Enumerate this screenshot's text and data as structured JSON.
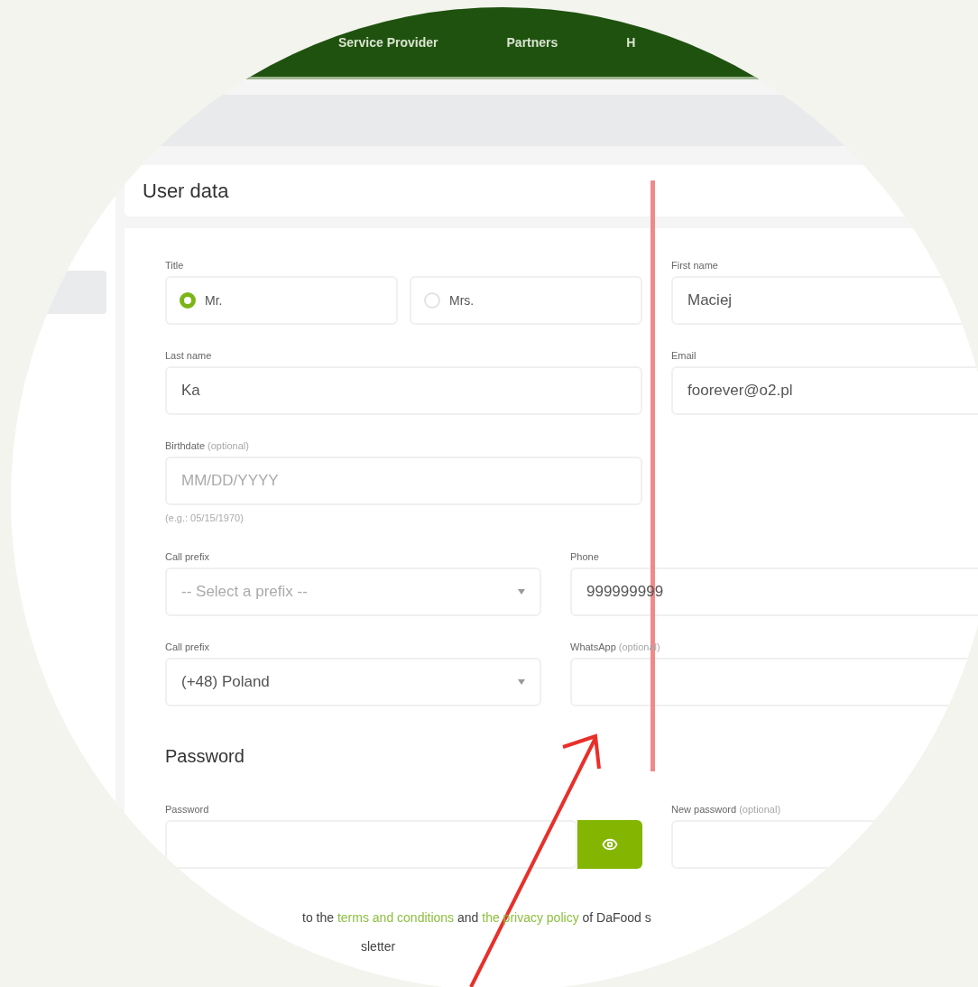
{
  "nav": {
    "items": [
      "Service Provider",
      "Partners",
      "H"
    ]
  },
  "header": {
    "title": "User data"
  },
  "form": {
    "title_field": {
      "label": "Title",
      "options": [
        {
          "label": "Mr.",
          "selected": true
        },
        {
          "label": "Mrs.",
          "selected": false
        }
      ]
    },
    "first_name": {
      "label": "First name",
      "value": "Maciej"
    },
    "last_name": {
      "label": "Last name",
      "value": "Ka"
    },
    "email": {
      "label": "Email",
      "value": "foorever@o2.pl"
    },
    "birthdate": {
      "label": "Birthdate",
      "note": "(optional)",
      "placeholder": "MM/DD/YYYY",
      "hint": "(e.g.: 05/15/1970)"
    },
    "call_prefix": {
      "label": "Call prefix",
      "placeholder": "-- Select a prefix --"
    },
    "phone": {
      "label": "Phone",
      "value": "999999999"
    },
    "whatsapp_prefix": {
      "label": "Call prefix",
      "value": "(+48) Poland"
    },
    "whatsapp": {
      "label": "WhatsApp",
      "note": "(optional)"
    },
    "password_heading": "Password",
    "password": {
      "label": "Password"
    },
    "new_password": {
      "label": "New password",
      "note": "(optional)"
    },
    "terms": {
      "before": "to the ",
      "terms_link": "terms and conditions",
      "middle": " and ",
      "privacy_link": "the privacy policy",
      "after": " of DaFood s"
    },
    "newsletter": "sletter"
  }
}
